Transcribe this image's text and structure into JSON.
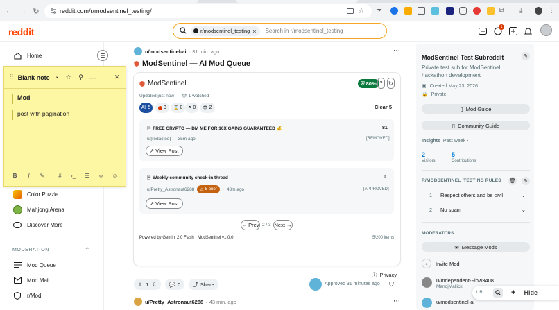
{
  "browser": {
    "url": "reddit.com/r/modsentinel_testing/"
  },
  "header": {
    "logo": "reddit",
    "search_chip": "r/modsentinel_testing",
    "search_placeholder": "Search in r/modsentinel_testing",
    "notification_count": "1"
  },
  "sidebar": {
    "home": "Home",
    "games": [
      "Color Puzzle",
      "Mahjong Arena"
    ],
    "discover": "Discover More",
    "moderation_heading": "MODERATION",
    "moderation_items": [
      "Mod Queue",
      "Mod Mail",
      "r/Mod"
    ]
  },
  "note": {
    "title": "Blank note",
    "heading": "Mod",
    "body": "post with pagination"
  },
  "post": {
    "author": "u/modsentinel-ai",
    "time": "31 min. ago",
    "title": "ModSentinel — AI Mod Queue",
    "votes": "1",
    "comments": "0",
    "share": "Share",
    "approved": "Approved 31 minutes ago",
    "privacy": "Privacy"
  },
  "widget": {
    "name": "ModSentinel",
    "score": "80%",
    "updated": "Updated just now",
    "watched": "1 watched",
    "filters": [
      {
        "label": "All 5",
        "active": true
      },
      {
        "label": "3",
        "color": "#d93a00"
      },
      {
        "label": "0",
        "color": "#7c7c7c"
      },
      {
        "label": "0",
        "color": "#0079d3"
      },
      {
        "label": "2",
        "color": "#7c7c7c"
      }
    ],
    "clear": "Clear 5",
    "items": [
      {
        "title": "FREE CRYPTO — DM ME FOR 10X GAINS GUARANTEED 💰",
        "score": "81",
        "author": "u/[redacted]",
        "time": "35m ago",
        "status": "[REMOVED]",
        "action": "View Post"
      },
      {
        "title": "Weekly community check-in thread",
        "score": "0",
        "author": "u/Pretty_Astronaut6288",
        "badge": "5 prior",
        "time": "43m ago",
        "status": "[APPROVED]",
        "action": "View Post"
      }
    ],
    "prev": "← Prev",
    "page": "2 / 3",
    "next": "Next →",
    "footer": "Powered by Gemini 2.0 Flash · ModSentinel v1.0.0",
    "count": "5/200 items"
  },
  "next_post": {
    "author": "u/Pretty_Astronaut6288",
    "time": "43 min. ago"
  },
  "subreddit": {
    "name": "ModSentinel Test Subreddit",
    "description": "Private test sub for ModSentinel hackathon development",
    "created": "Created May 23, 2026",
    "privacy": "Private",
    "mod_guide": "Mod Guide",
    "community_guide": "Community Guide",
    "insights": "Insights",
    "period": "Past week",
    "visitors": "2",
    "visitors_label": "Visitors",
    "contributions": "5",
    "contributions_label": "Contributions",
    "rules_heading": "R/MODSENTINEL_TESTING RULES",
    "rules": [
      {
        "num": "1",
        "text": "Respect others and be civil"
      },
      {
        "num": "2",
        "text": "No spam"
      }
    ],
    "moderators_heading": "MODERATORS",
    "message_mods": "Message Mods",
    "invite_mod": "Invite Mod",
    "moderators": [
      {
        "name": "u/Independent-Flow3408",
        "flair": "ManojMallick"
      },
      {
        "name": "u/modsentinel-ai",
        "flair": ""
      }
    ]
  },
  "floating": {
    "url_label": "URL",
    "hide": "Hide"
  },
  "colors": {
    "reddit_orange": "#ff4500",
    "link_blue": "#0079d3",
    "note_yellow": "#fdf6a3",
    "score_green": "#0b7a3e"
  }
}
